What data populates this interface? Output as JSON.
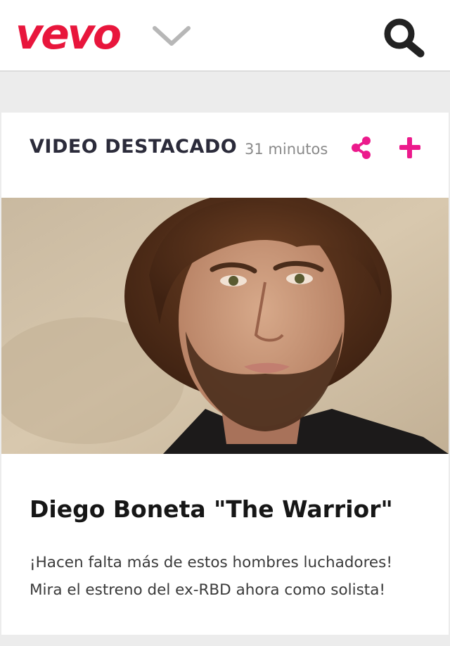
{
  "header": {
    "logo_text": "vevo",
    "menu_icon": "chevron-down-icon",
    "search_icon": "search-icon"
  },
  "featured": {
    "section_title": "VIDEO DESTACADO",
    "timestamp": "31 minutos",
    "share_icon": "share-icon",
    "add_icon": "plus-icon",
    "video_title": "Diego Boneta \"The Warrior\"",
    "description_line1": "¡Hacen falta más de estos hombres luchadores!",
    "description_line2": "Mira el estreno del ex-RBD ahora como solista!"
  },
  "colors": {
    "brand": "#e8163c",
    "accent": "#ec1a8c",
    "icon_dark": "#222222"
  }
}
